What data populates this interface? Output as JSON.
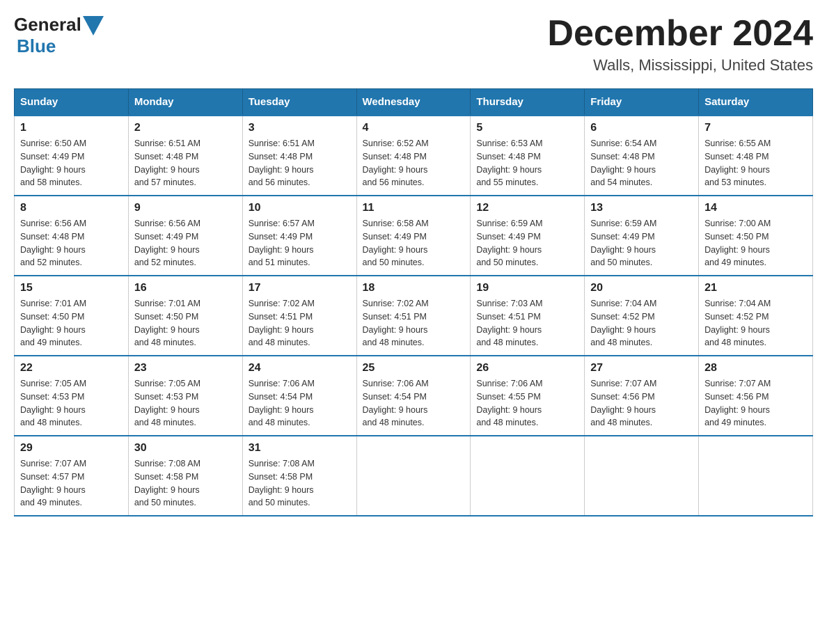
{
  "header": {
    "logo_general": "General",
    "logo_blue": "Blue",
    "month_title": "December 2024",
    "location": "Walls, Mississippi, United States"
  },
  "weekdays": [
    "Sunday",
    "Monday",
    "Tuesday",
    "Wednesday",
    "Thursday",
    "Friday",
    "Saturday"
  ],
  "weeks": [
    [
      {
        "day": "1",
        "sunrise": "6:50 AM",
        "sunset": "4:49 PM",
        "daylight": "9 hours and 58 minutes."
      },
      {
        "day": "2",
        "sunrise": "6:51 AM",
        "sunset": "4:48 PM",
        "daylight": "9 hours and 57 minutes."
      },
      {
        "day": "3",
        "sunrise": "6:51 AM",
        "sunset": "4:48 PM",
        "daylight": "9 hours and 56 minutes."
      },
      {
        "day": "4",
        "sunrise": "6:52 AM",
        "sunset": "4:48 PM",
        "daylight": "9 hours and 56 minutes."
      },
      {
        "day": "5",
        "sunrise": "6:53 AM",
        "sunset": "4:48 PM",
        "daylight": "9 hours and 55 minutes."
      },
      {
        "day": "6",
        "sunrise": "6:54 AM",
        "sunset": "4:48 PM",
        "daylight": "9 hours and 54 minutes."
      },
      {
        "day": "7",
        "sunrise": "6:55 AM",
        "sunset": "4:48 PM",
        "daylight": "9 hours and 53 minutes."
      }
    ],
    [
      {
        "day": "8",
        "sunrise": "6:56 AM",
        "sunset": "4:48 PM",
        "daylight": "9 hours and 52 minutes."
      },
      {
        "day": "9",
        "sunrise": "6:56 AM",
        "sunset": "4:49 PM",
        "daylight": "9 hours and 52 minutes."
      },
      {
        "day": "10",
        "sunrise": "6:57 AM",
        "sunset": "4:49 PM",
        "daylight": "9 hours and 51 minutes."
      },
      {
        "day": "11",
        "sunrise": "6:58 AM",
        "sunset": "4:49 PM",
        "daylight": "9 hours and 50 minutes."
      },
      {
        "day": "12",
        "sunrise": "6:59 AM",
        "sunset": "4:49 PM",
        "daylight": "9 hours and 50 minutes."
      },
      {
        "day": "13",
        "sunrise": "6:59 AM",
        "sunset": "4:49 PM",
        "daylight": "9 hours and 50 minutes."
      },
      {
        "day": "14",
        "sunrise": "7:00 AM",
        "sunset": "4:50 PM",
        "daylight": "9 hours and 49 minutes."
      }
    ],
    [
      {
        "day": "15",
        "sunrise": "7:01 AM",
        "sunset": "4:50 PM",
        "daylight": "9 hours and 49 minutes."
      },
      {
        "day": "16",
        "sunrise": "7:01 AM",
        "sunset": "4:50 PM",
        "daylight": "9 hours and 48 minutes."
      },
      {
        "day": "17",
        "sunrise": "7:02 AM",
        "sunset": "4:51 PM",
        "daylight": "9 hours and 48 minutes."
      },
      {
        "day": "18",
        "sunrise": "7:02 AM",
        "sunset": "4:51 PM",
        "daylight": "9 hours and 48 minutes."
      },
      {
        "day": "19",
        "sunrise": "7:03 AM",
        "sunset": "4:51 PM",
        "daylight": "9 hours and 48 minutes."
      },
      {
        "day": "20",
        "sunrise": "7:04 AM",
        "sunset": "4:52 PM",
        "daylight": "9 hours and 48 minutes."
      },
      {
        "day": "21",
        "sunrise": "7:04 AM",
        "sunset": "4:52 PM",
        "daylight": "9 hours and 48 minutes."
      }
    ],
    [
      {
        "day": "22",
        "sunrise": "7:05 AM",
        "sunset": "4:53 PM",
        "daylight": "9 hours and 48 minutes."
      },
      {
        "day": "23",
        "sunrise": "7:05 AM",
        "sunset": "4:53 PM",
        "daylight": "9 hours and 48 minutes."
      },
      {
        "day": "24",
        "sunrise": "7:06 AM",
        "sunset": "4:54 PM",
        "daylight": "9 hours and 48 minutes."
      },
      {
        "day": "25",
        "sunrise": "7:06 AM",
        "sunset": "4:54 PM",
        "daylight": "9 hours and 48 minutes."
      },
      {
        "day": "26",
        "sunrise": "7:06 AM",
        "sunset": "4:55 PM",
        "daylight": "9 hours and 48 minutes."
      },
      {
        "day": "27",
        "sunrise": "7:07 AM",
        "sunset": "4:56 PM",
        "daylight": "9 hours and 48 minutes."
      },
      {
        "day": "28",
        "sunrise": "7:07 AM",
        "sunset": "4:56 PM",
        "daylight": "9 hours and 49 minutes."
      }
    ],
    [
      {
        "day": "29",
        "sunrise": "7:07 AM",
        "sunset": "4:57 PM",
        "daylight": "9 hours and 49 minutes."
      },
      {
        "day": "30",
        "sunrise": "7:08 AM",
        "sunset": "4:58 PM",
        "daylight": "9 hours and 50 minutes."
      },
      {
        "day": "31",
        "sunrise": "7:08 AM",
        "sunset": "4:58 PM",
        "daylight": "9 hours and 50 minutes."
      },
      null,
      null,
      null,
      null
    ]
  ],
  "labels": {
    "sunrise": "Sunrise:",
    "sunset": "Sunset:",
    "daylight": "Daylight:"
  }
}
